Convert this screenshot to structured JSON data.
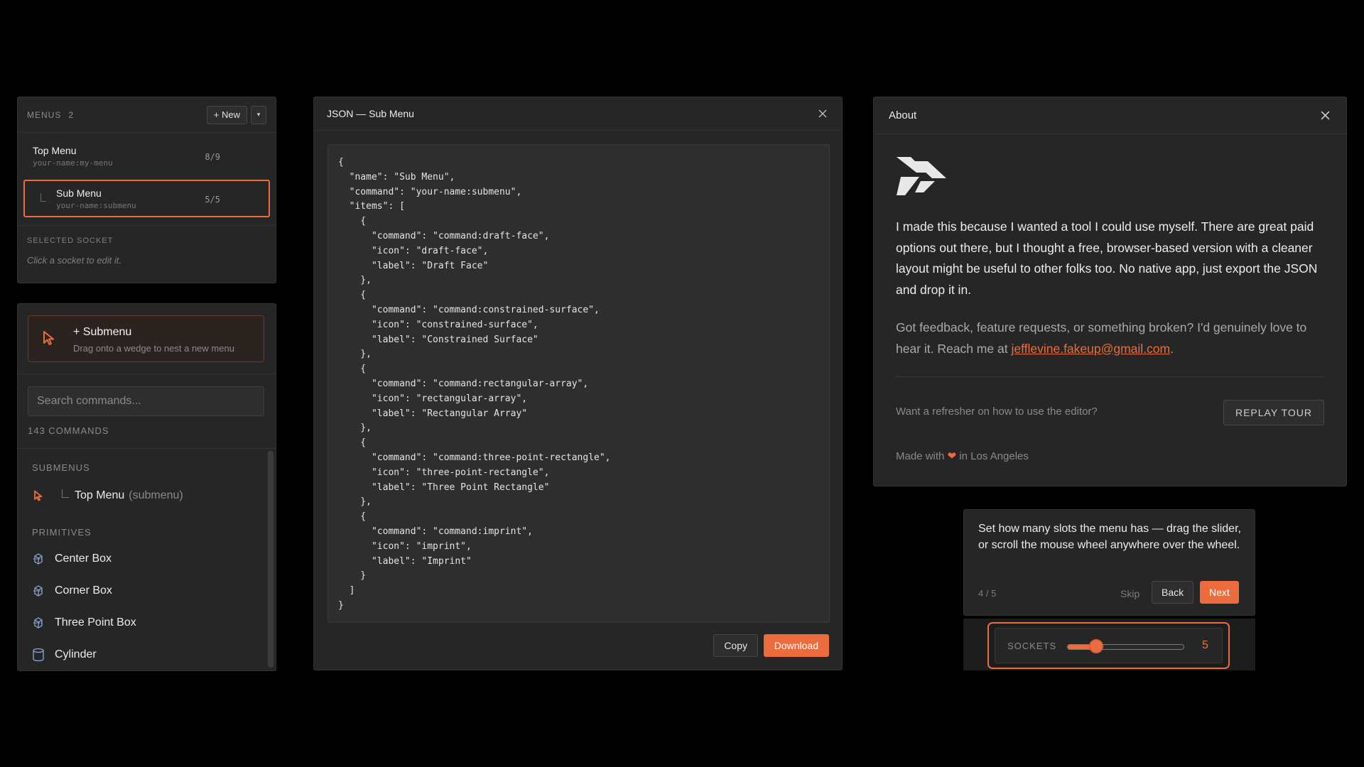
{
  "colors": {
    "accent": "#ec6c3d",
    "background": "#000000",
    "panel": "#262626"
  },
  "menus": {
    "title": "MENUS",
    "count": "2",
    "new_label": "+ New",
    "dropdown_glyph": "▾",
    "items": [
      {
        "name": "Top Menu",
        "command": "your-name:my-menu",
        "slots": "8/9"
      },
      {
        "name": "Sub Menu",
        "command": "your-name:submenu",
        "slots": "5/5"
      }
    ],
    "selected_socket_label": "SELECTED SOCKET",
    "selected_socket_hint": "Click a socket to edit it."
  },
  "commands": {
    "submenu_card": {
      "title": "+ Submenu",
      "subtitle": "Drag onto a wedge to nest a new menu",
      "icon": "cursor-icon"
    },
    "search_placeholder": "Search commands...",
    "count_label": "143 COMMANDS",
    "submenus_label": "SUBMENUS",
    "submenu_items": [
      {
        "name": "Top Menu",
        "suffix": "(submenu)",
        "icon": "cursor-icon"
      }
    ],
    "primitives_label": "PRIMITIVES",
    "primitives": [
      {
        "name": "Center Box",
        "icon": "box-icon"
      },
      {
        "name": "Corner Box",
        "icon": "box-icon"
      },
      {
        "name": "Three Point Box",
        "icon": "box-icon"
      },
      {
        "name": "Cylinder",
        "icon": "cylinder-icon"
      }
    ]
  },
  "json_modal": {
    "title": "JSON — Sub Menu",
    "code": "{\n  \"name\": \"Sub Menu\",\n  \"command\": \"your-name:submenu\",\n  \"items\": [\n    {\n      \"command\": \"command:draft-face\",\n      \"icon\": \"draft-face\",\n      \"label\": \"Draft Face\"\n    },\n    {\n      \"command\": \"command:constrained-surface\",\n      \"icon\": \"constrained-surface\",\n      \"label\": \"Constrained Surface\"\n    },\n    {\n      \"command\": \"command:rectangular-array\",\n      \"icon\": \"rectangular-array\",\n      \"label\": \"Rectangular Array\"\n    },\n    {\n      \"command\": \"command:three-point-rectangle\",\n      \"icon\": \"three-point-rectangle\",\n      \"label\": \"Three Point Rectangle\"\n    },\n    {\n      \"command\": \"command:imprint\",\n      \"icon\": \"imprint\",\n      \"label\": \"Imprint\"\n    }\n  ]\n}",
    "copy_label": "Copy",
    "download_label": "Download"
  },
  "about_modal": {
    "title": "About",
    "paragraph1": "I made this because I wanted a tool I could use myself. There are great paid options out there, but I thought a free, browser-based version with a cleaner layout might be useful to other folks too. No native app, just export the JSON and drop it in.",
    "paragraph2_before": "Got feedback, feature requests, or something broken? I'd genuinely love to hear it. Reach me at ",
    "email": "jefflevine.fakeup@gmail.com",
    "paragraph2_after": ".",
    "refresher_text": "Want a refresher on how to use the editor?",
    "replay_label": "REPLAY TOUR",
    "made_before": "Made with ",
    "heart": "❤",
    "made_after": " in Los Angeles"
  },
  "tour": {
    "text": "Set how many slots the menu has — drag the slider, or scroll the mouse wheel anywhere over the wheel.",
    "step": "4 / 5",
    "skip_label": "Skip",
    "back_label": "Back",
    "next_label": "Next"
  },
  "sockets": {
    "label": "SOCKETS",
    "value": "5",
    "level": 0.25
  }
}
